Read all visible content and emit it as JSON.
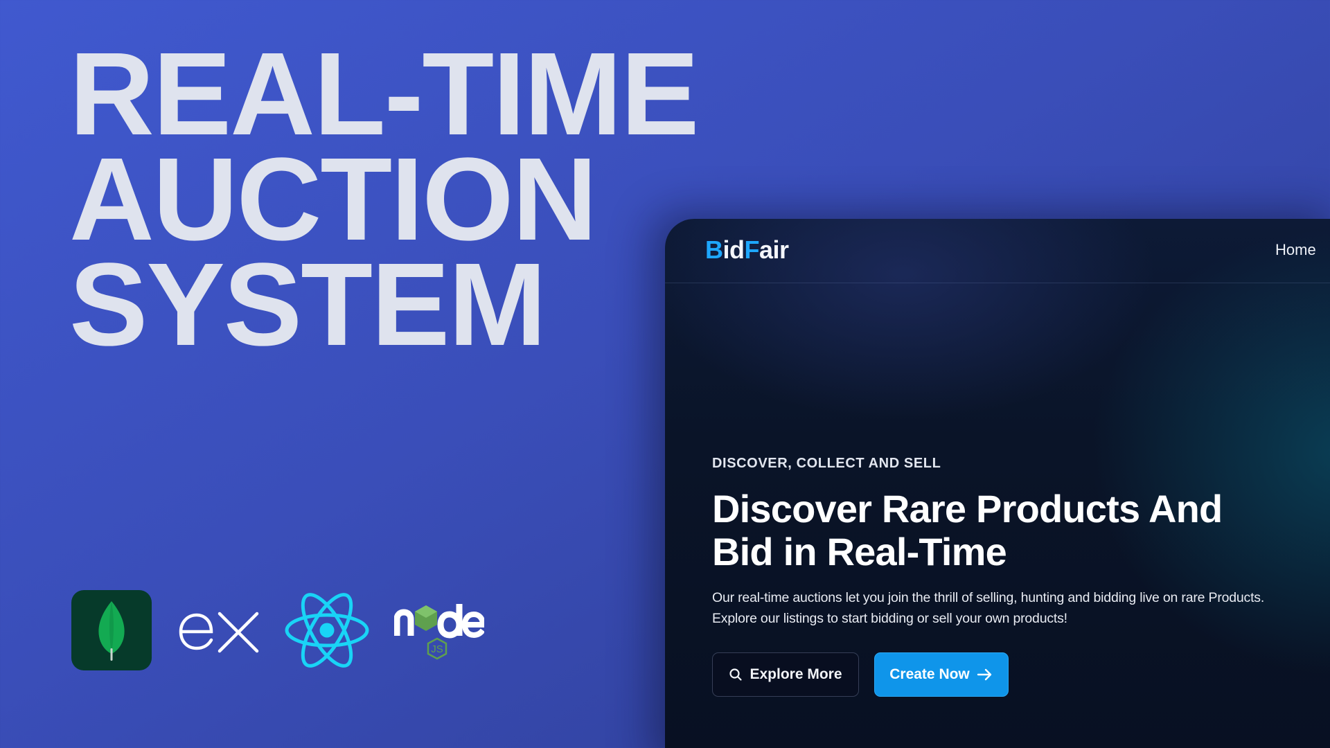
{
  "thumbnail": {
    "title_lines": [
      "REAL-TIME",
      "AUCTION",
      "SYSTEM"
    ],
    "tech_logos": [
      "mongodb-icon",
      "express-icon",
      "react-icon",
      "nodejs-icon"
    ],
    "background_colors": [
      "#4059cf",
      "#2e3d93"
    ]
  },
  "app": {
    "brand": {
      "first_letter": "B",
      "part2": "id",
      "part3": "F",
      "part4": "air"
    },
    "nav": {
      "home_label": "Home"
    },
    "hero": {
      "eyebrow": "DISCOVER, COLLECT AND SELL",
      "headline_lines": [
        "Discover Rare Products And",
        "Bid in Real-Time"
      ],
      "description_lines": [
        "Our real-time auctions let you join the thrill of selling, hunting and bidding live on rare Products.",
        "Explore our listings to start bidding or sell your own products!"
      ],
      "explore_label": "Explore More",
      "create_label": "Create Now"
    },
    "colors": {
      "accent": "#1ea7ff",
      "button_primary": "#0f95ea",
      "panel_bg": "#0a1428"
    }
  }
}
